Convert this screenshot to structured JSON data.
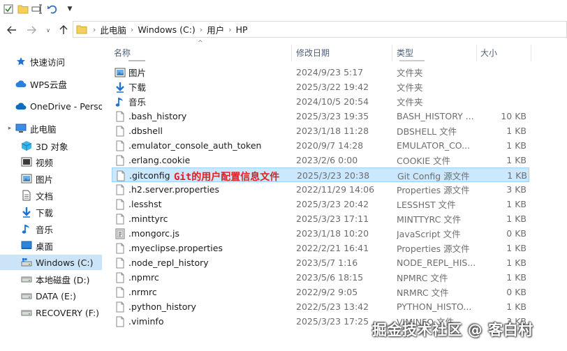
{
  "address": {
    "segments": [
      "此电脑",
      "Windows (C:)",
      "用户",
      "HP"
    ]
  },
  "sidebar": {
    "items": [
      {
        "label": "快速访问",
        "icon": "star-icon"
      },
      {
        "label": "WPS云盘",
        "icon": "cloud-icon"
      },
      {
        "label": "OneDrive - Perso",
        "icon": "onedrive-cloud-icon"
      },
      {
        "label": "此电脑",
        "icon": "computer-icon"
      },
      {
        "label": "3D 对象",
        "icon": "cube-icon"
      },
      {
        "label": "视频",
        "icon": "video-icon"
      },
      {
        "label": "图片",
        "icon": "picture-icon"
      },
      {
        "label": "文档",
        "icon": "document-icon"
      },
      {
        "label": "下载",
        "icon": "download-arrow-icon"
      },
      {
        "label": "音乐",
        "icon": "music-note-icon"
      },
      {
        "label": "桌面",
        "icon": "desktop-icon"
      },
      {
        "label": "Windows (C:)",
        "icon": "windows-drive-icon"
      },
      {
        "label": "本地磁盘 (D:)",
        "icon": "drive-icon"
      },
      {
        "label": "DATA (E:)",
        "icon": "drive-icon"
      },
      {
        "label": "RECOVERY (F:)",
        "icon": "drive-icon"
      }
    ]
  },
  "columns": {
    "name": "名称",
    "date": "修改日期",
    "type": "类型",
    "size": "大小"
  },
  "files": [
    {
      "name": "图片",
      "date": "2024/9/23 5:17",
      "type": "文件夹",
      "size": "",
      "icon": "picture-folder-icon"
    },
    {
      "name": "下载",
      "date": "2025/3/22 19:42",
      "type": "文件夹",
      "size": "",
      "icon": "download-arrow-icon"
    },
    {
      "name": "音乐",
      "date": "2024/10/5 20:54",
      "type": "文件夹",
      "size": "",
      "icon": "music-note-icon"
    },
    {
      "name": ".bash_history",
      "date": "2025/3/23 19:35",
      "type": "BASH_HISTORY ...",
      "size": "10 KB",
      "icon": "file-icon"
    },
    {
      "name": ".dbshell",
      "date": "2023/1/18 11:28",
      "type": "DBSHELL 文件",
      "size": "1 KB",
      "icon": "file-icon"
    },
    {
      "name": ".emulator_console_auth_token",
      "date": "2020/9/7 14:28",
      "type": "EMULATOR_CO...",
      "size": "1 KB",
      "icon": "file-icon"
    },
    {
      "name": ".erlang.cookie",
      "date": "2023/2/6 0:00",
      "type": "COOKIE 文件",
      "size": "1 KB",
      "icon": "file-icon"
    },
    {
      "name": ".gitconfig",
      "date": "2025/3/23 20:38",
      "type": "Git Config 源文件",
      "size": "1 KB",
      "icon": "file-icon"
    },
    {
      "name": ".h2.server.properties",
      "date": "2022/11/29 14:06",
      "type": "Properties 源文件",
      "size": "3 KB",
      "icon": "file-icon"
    },
    {
      "name": ".lesshst",
      "date": "2025/3/23 20:42",
      "type": "LESSHST 文件",
      "size": "1 KB",
      "icon": "file-icon"
    },
    {
      "name": ".minttyrc",
      "date": "2025/3/23 17:11",
      "type": "MINTTYRC 文件",
      "size": "1 KB",
      "icon": "file-icon"
    },
    {
      "name": ".mongorc.js",
      "date": "2023/1/18 10:20",
      "type": "JavaScript 文件",
      "size": "0 KB",
      "icon": "javascript-file-icon"
    },
    {
      "name": ".myeclipse.properties",
      "date": "2022/2/21 16:41",
      "type": "Properties 源文件",
      "size": "1 KB",
      "icon": "file-icon"
    },
    {
      "name": ".node_repl_history",
      "date": "2023/5/7 1:16",
      "type": "NODE_REPL_HIS...",
      "size": "1 KB",
      "icon": "file-icon"
    },
    {
      "name": ".npmrc",
      "date": "2023/5/6 18:15",
      "type": "NPMRC 文件",
      "size": "1 KB",
      "icon": "file-icon"
    },
    {
      "name": ".nrmrc",
      "date": "2022/9/2 9:05",
      "type": "NRMRC 文件",
      "size": "0 KB",
      "icon": "file-icon"
    },
    {
      "name": ".python_history",
      "date": "2022/5/23 13:42",
      "type": "PYTHON_HISTO...",
      "size": "1 KB",
      "icon": "file-icon"
    },
    {
      "name": ".viminfo",
      "date": "2025/3/23 17:25",
      "type": "VIMINFO 文件",
      "size": "3 KB",
      "icon": "file-icon"
    }
  ],
  "annotation": "Git的用户配置信息文件",
  "watermark": "掘金技术社区 @ 客白村",
  "colors": {
    "selection": "#cce8ff",
    "selection_border": "#99d1ff",
    "sidebar_selection": "#cce4f7",
    "annotation": "#e02020",
    "header_text": "#4c607a"
  }
}
